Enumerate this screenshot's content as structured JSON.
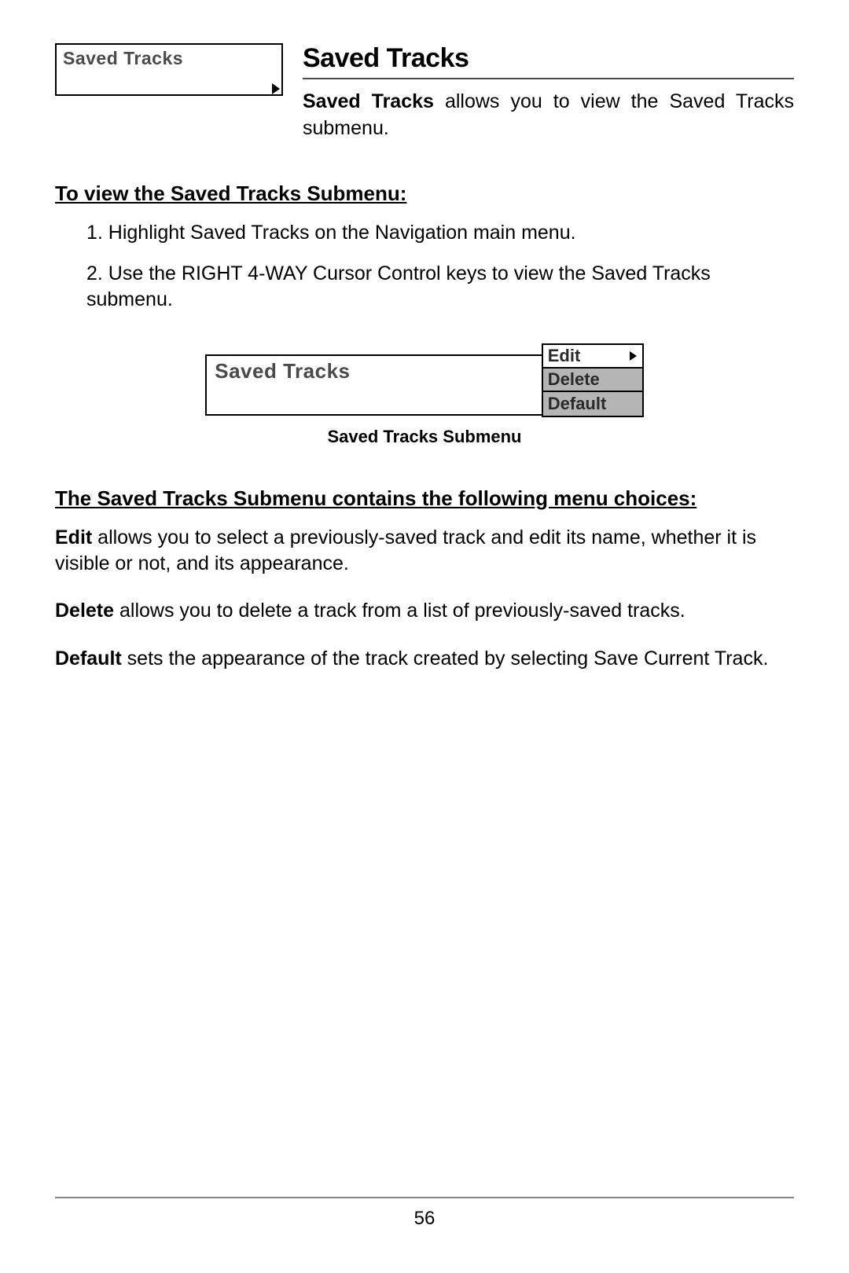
{
  "top_menu_box": {
    "label": "Saved Tracks"
  },
  "heading": "Saved Tracks",
  "intro": {
    "bold": "Saved Tracks",
    "rest": " allows you to view the Saved Tracks submenu."
  },
  "section1_heading": "To view the Saved Tracks Submenu:",
  "steps": [
    "1.  Highlight Saved Tracks on the Navigation main menu.",
    "2.  Use the RIGHT 4-WAY Cursor Control keys to view the Saved Tracks submenu."
  ],
  "submenu_box": {
    "label": "Saved Tracks",
    "items": [
      "Edit",
      "Delete",
      "Default"
    ]
  },
  "figure_caption": "Saved Tracks Submenu",
  "section2_heading": "The Saved Tracks Submenu contains the following menu choices:",
  "paragraphs": [
    {
      "bold": "Edit",
      "rest": " allows you to select a previously-saved track and edit its name, whether it is visible or not, and its appearance."
    },
    {
      "bold": "Delete",
      "rest": " allows you to delete a track from a list of previously-saved tracks."
    },
    {
      "bold": "Default",
      "rest": " sets the appearance of the track created by selecting Save Current Track."
    }
  ],
  "page_number": "56"
}
